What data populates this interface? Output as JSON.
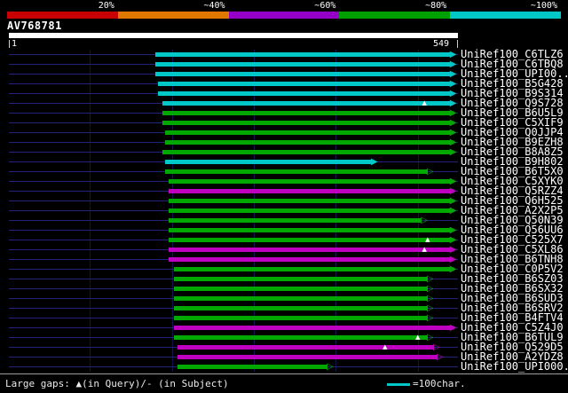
{
  "chart_data": {
    "type": "bar",
    "scale": {
      "segments": [
        {
          "label": "20%",
          "color": "#c80000"
        },
        {
          "label": "~40%",
          "color": "#e07800"
        },
        {
          "label": "~60%",
          "color": "#9400c8"
        },
        {
          "label": "~80%",
          "color": "#00a000"
        },
        {
          "label": "~100%",
          "color": "#00c8c8"
        }
      ]
    },
    "query": {
      "name": "AV768781",
      "start_label": "1",
      "end_label": "549",
      "length": 549
    },
    "plot": {
      "xlim": [
        1,
        549
      ],
      "gridlines": [
        100,
        200,
        300,
        400,
        500
      ],
      "baseline_color": "#22227c",
      "gridline_color": "#14144a"
    },
    "identity_colors": {
      "~100%": "#00c8c8",
      "~80%": "#00a800",
      "~60%": "#c000c0"
    },
    "hits": [
      {
        "label": "UniRef100_C6TLZ6",
        "identity": "~100%",
        "qstart": 180,
        "qend": 540,
        "arrow": "filled",
        "gaps": []
      },
      {
        "label": "UniRef100_C6TBQ8",
        "identity": "~100%",
        "qstart": 180,
        "qend": 540,
        "arrow": "filled",
        "gaps": []
      },
      {
        "label": "UniRef100_UPI00..",
        "identity": "~100%",
        "qstart": 180,
        "qend": 540,
        "arrow": "filled",
        "gaps": []
      },
      {
        "label": "UniRef100_B5G428",
        "identity": "~100%",
        "qstart": 183,
        "qend": 540,
        "arrow": "filled",
        "gaps": []
      },
      {
        "label": "UniRef100_B9S314",
        "identity": "~100%",
        "qstart": 183,
        "qend": 540,
        "arrow": "filled",
        "gaps": []
      },
      {
        "label": "UniRef100_Q9S728",
        "identity": "~100%",
        "qstart": 188,
        "qend": 540,
        "arrow": "filled",
        "gaps": [
          508
        ]
      },
      {
        "label": "UniRef100_B6U5L9",
        "identity": "~80%",
        "qstart": 188,
        "qend": 540,
        "arrow": "filled",
        "gaps": []
      },
      {
        "label": "UniRef100_C5XIF9",
        "identity": "~80%",
        "qstart": 188,
        "qend": 540,
        "arrow": "filled",
        "gaps": []
      },
      {
        "label": "UniRef100_Q0JJP4",
        "identity": "~80%",
        "qstart": 192,
        "qend": 540,
        "arrow": "filled",
        "gaps": []
      },
      {
        "label": "UniRef100_B9EZH8",
        "identity": "~80%",
        "qstart": 192,
        "qend": 540,
        "arrow": "filled",
        "gaps": []
      },
      {
        "label": "UniRef100_B8A8Z5",
        "identity": "~80%",
        "qstart": 188,
        "qend": 540,
        "arrow": "filled",
        "gaps": []
      },
      {
        "label": "UniRef100_B9H802",
        "identity": "~100%",
        "qstart": 192,
        "qend": 444,
        "arrow": "filled",
        "gaps": []
      },
      {
        "label": "UniRef100_B6T5X0",
        "identity": "~80%",
        "qstart": 192,
        "qend": 512,
        "arrow": "open",
        "gaps": []
      },
      {
        "label": "UniRef100_C5XYK0",
        "identity": "~80%",
        "qstart": 196,
        "qend": 540,
        "arrow": "filled",
        "gaps": []
      },
      {
        "label": "UniRef100_Q5RZZ4",
        "identity": "~60%",
        "qstart": 196,
        "qend": 540,
        "arrow": "filled",
        "gaps": []
      },
      {
        "label": "UniRef100_Q6H525",
        "identity": "~80%",
        "qstart": 196,
        "qend": 540,
        "arrow": "filled",
        "gaps": []
      },
      {
        "label": "UniRef100_A2X2P5",
        "identity": "~80%",
        "qstart": 196,
        "qend": 540,
        "arrow": "filled",
        "gaps": []
      },
      {
        "label": "UniRef100_Q50N39",
        "identity": "~80%",
        "qstart": 196,
        "qend": 505,
        "arrow": "open",
        "gaps": []
      },
      {
        "label": "UniRef100_Q56UU6",
        "identity": "~80%",
        "qstart": 196,
        "qend": 540,
        "arrow": "filled",
        "gaps": []
      },
      {
        "label": "UniRef100_C525X7",
        "identity": "~80%",
        "qstart": 196,
        "qend": 540,
        "arrow": "filled",
        "gaps": [
          512
        ]
      },
      {
        "label": "UniRef100_C5XL86",
        "identity": "~60%",
        "qstart": 196,
        "qend": 540,
        "arrow": "filled",
        "gaps": [
          508
        ]
      },
      {
        "label": "UniRef100_B6TNH8",
        "identity": "~60%",
        "qstart": 196,
        "qend": 540,
        "arrow": "filled",
        "gaps": []
      },
      {
        "label": "UniRef100_C0P5V2",
        "identity": "~80%",
        "qstart": 202,
        "qend": 540,
        "arrow": "filled",
        "gaps": []
      },
      {
        "label": "UniRef100_B6SZ03",
        "identity": "~80%",
        "qstart": 202,
        "qend": 512,
        "arrow": "open",
        "gaps": []
      },
      {
        "label": "UniRef100_B6SX32",
        "identity": "~80%",
        "qstart": 202,
        "qend": 512,
        "arrow": "open",
        "gaps": []
      },
      {
        "label": "UniRef100_B6SUD3",
        "identity": "~80%",
        "qstart": 202,
        "qend": 512,
        "arrow": "open",
        "gaps": []
      },
      {
        "label": "UniRef100_B6SRV2",
        "identity": "~80%",
        "qstart": 202,
        "qend": 512,
        "arrow": "open",
        "gaps": []
      },
      {
        "label": "UniRef100_B4FTV4",
        "identity": "~80%",
        "qstart": 202,
        "qend": 512,
        "arrow": "open",
        "gaps": []
      },
      {
        "label": "UniRef100_C5Z4J0",
        "identity": "~60%",
        "qstart": 202,
        "qend": 540,
        "arrow": "filled",
        "gaps": []
      },
      {
        "label": "UniRef100_B6TUL9",
        "identity": "~80%",
        "qstart": 202,
        "qend": 512,
        "arrow": "open",
        "gaps": [
          500
        ]
      },
      {
        "label": "UniRef100_Q529D5",
        "identity": "~60%",
        "qstart": 207,
        "qend": 520,
        "arrow": "open",
        "gaps": [
          460
        ]
      },
      {
        "label": "UniRef100_A2YDZ8",
        "identity": "~60%",
        "qstart": 207,
        "qend": 524,
        "arrow": "open",
        "gaps": []
      },
      {
        "label": "UniRef100_UPI000..",
        "identity": "~80%",
        "qstart": 207,
        "qend": 390,
        "arrow": "open",
        "gaps": []
      }
    ],
    "footer": {
      "gaps_note": "Large gaps: ▲(in Query)/- (in Subject)",
      "scale_label": "=100char.",
      "scale_line_color": "#00c8c8"
    }
  }
}
